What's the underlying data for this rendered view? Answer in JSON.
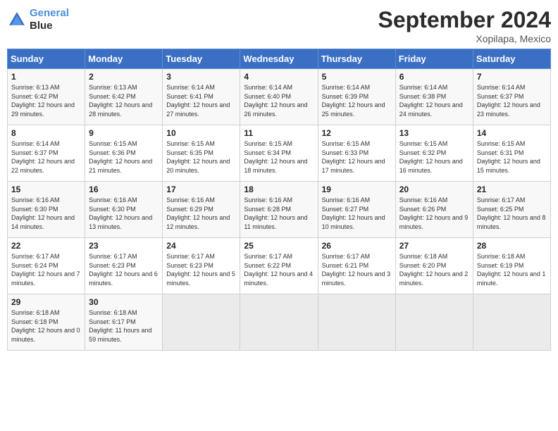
{
  "header": {
    "logo_line1": "General",
    "logo_line2": "Blue",
    "month": "September 2024",
    "location": "Xopilapa, Mexico"
  },
  "days_of_week": [
    "Sunday",
    "Monday",
    "Tuesday",
    "Wednesday",
    "Thursday",
    "Friday",
    "Saturday"
  ],
  "weeks": [
    [
      {
        "day": 1,
        "sunrise": "6:13 AM",
        "sunset": "6:42 PM",
        "daylight": "12 hours and 29 minutes."
      },
      {
        "day": 2,
        "sunrise": "6:13 AM",
        "sunset": "6:42 PM",
        "daylight": "12 hours and 28 minutes."
      },
      {
        "day": 3,
        "sunrise": "6:14 AM",
        "sunset": "6:41 PM",
        "daylight": "12 hours and 27 minutes."
      },
      {
        "day": 4,
        "sunrise": "6:14 AM",
        "sunset": "6:40 PM",
        "daylight": "12 hours and 26 minutes."
      },
      {
        "day": 5,
        "sunrise": "6:14 AM",
        "sunset": "6:39 PM",
        "daylight": "12 hours and 25 minutes."
      },
      {
        "day": 6,
        "sunrise": "6:14 AM",
        "sunset": "6:38 PM",
        "daylight": "12 hours and 24 minutes."
      },
      {
        "day": 7,
        "sunrise": "6:14 AM",
        "sunset": "6:37 PM",
        "daylight": "12 hours and 23 minutes."
      }
    ],
    [
      {
        "day": 8,
        "sunrise": "6:14 AM",
        "sunset": "6:37 PM",
        "daylight": "12 hours and 22 minutes."
      },
      {
        "day": 9,
        "sunrise": "6:15 AM",
        "sunset": "6:36 PM",
        "daylight": "12 hours and 21 minutes."
      },
      {
        "day": 10,
        "sunrise": "6:15 AM",
        "sunset": "6:35 PM",
        "daylight": "12 hours and 20 minutes."
      },
      {
        "day": 11,
        "sunrise": "6:15 AM",
        "sunset": "6:34 PM",
        "daylight": "12 hours and 18 minutes."
      },
      {
        "day": 12,
        "sunrise": "6:15 AM",
        "sunset": "6:33 PM",
        "daylight": "12 hours and 17 minutes."
      },
      {
        "day": 13,
        "sunrise": "6:15 AM",
        "sunset": "6:32 PM",
        "daylight": "12 hours and 16 minutes."
      },
      {
        "day": 14,
        "sunrise": "6:15 AM",
        "sunset": "6:31 PM",
        "daylight": "12 hours and 15 minutes."
      }
    ],
    [
      {
        "day": 15,
        "sunrise": "6:16 AM",
        "sunset": "6:30 PM",
        "daylight": "12 hours and 14 minutes."
      },
      {
        "day": 16,
        "sunrise": "6:16 AM",
        "sunset": "6:30 PM",
        "daylight": "12 hours and 13 minutes."
      },
      {
        "day": 17,
        "sunrise": "6:16 AM",
        "sunset": "6:29 PM",
        "daylight": "12 hours and 12 minutes."
      },
      {
        "day": 18,
        "sunrise": "6:16 AM",
        "sunset": "6:28 PM",
        "daylight": "12 hours and 11 minutes."
      },
      {
        "day": 19,
        "sunrise": "6:16 AM",
        "sunset": "6:27 PM",
        "daylight": "12 hours and 10 minutes."
      },
      {
        "day": 20,
        "sunrise": "6:16 AM",
        "sunset": "6:26 PM",
        "daylight": "12 hours and 9 minutes."
      },
      {
        "day": 21,
        "sunrise": "6:17 AM",
        "sunset": "6:25 PM",
        "daylight": "12 hours and 8 minutes."
      }
    ],
    [
      {
        "day": 22,
        "sunrise": "6:17 AM",
        "sunset": "6:24 PM",
        "daylight": "12 hours and 7 minutes."
      },
      {
        "day": 23,
        "sunrise": "6:17 AM",
        "sunset": "6:23 PM",
        "daylight": "12 hours and 6 minutes."
      },
      {
        "day": 24,
        "sunrise": "6:17 AM",
        "sunset": "6:23 PM",
        "daylight": "12 hours and 5 minutes."
      },
      {
        "day": 25,
        "sunrise": "6:17 AM",
        "sunset": "6:22 PM",
        "daylight": "12 hours and 4 minutes."
      },
      {
        "day": 26,
        "sunrise": "6:17 AM",
        "sunset": "6:21 PM",
        "daylight": "12 hours and 3 minutes."
      },
      {
        "day": 27,
        "sunrise": "6:18 AM",
        "sunset": "6:20 PM",
        "daylight": "12 hours and 2 minutes."
      },
      {
        "day": 28,
        "sunrise": "6:18 AM",
        "sunset": "6:19 PM",
        "daylight": "12 hours and 1 minute."
      }
    ],
    [
      {
        "day": 29,
        "sunrise": "6:18 AM",
        "sunset": "6:18 PM",
        "daylight": "12 hours and 0 minutes."
      },
      {
        "day": 30,
        "sunrise": "6:18 AM",
        "sunset": "6:17 PM",
        "daylight": "11 hours and 59 minutes."
      },
      null,
      null,
      null,
      null,
      null
    ]
  ]
}
